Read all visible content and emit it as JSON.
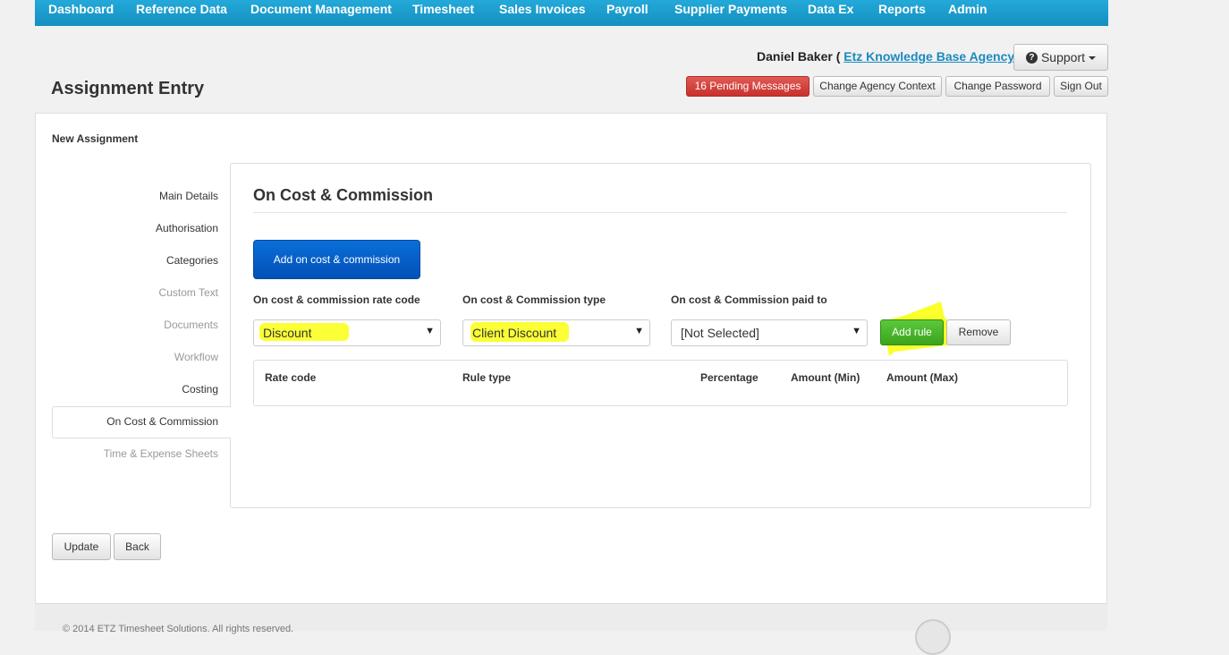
{
  "nav": {
    "items": [
      "Dashboard",
      "Reference Data",
      "Document Management",
      "Timesheet",
      "Sales Invoices",
      "Payroll",
      "Supplier Payments",
      "Data Ex",
      "Reports",
      "Admin"
    ]
  },
  "header": {
    "user_name": "Daniel Baker",
    "paren_open": "(",
    "agency_link": "Etz Knowledge Base Agency",
    "paren_close": ")",
    "support_label": "Support",
    "support_icon": "question-circle-icon",
    "pending_messages": "16 Pending Messages",
    "change_agency": "Change Agency Context",
    "change_password": "Change Password",
    "sign_out": "Sign Out",
    "pending_color": "#d9534f"
  },
  "page": {
    "title": "Assignment Entry",
    "subtitle": "New Assignment"
  },
  "sidenav": {
    "items": [
      {
        "label": "Main Details",
        "muted": false
      },
      {
        "label": "Authorisation",
        "muted": false
      },
      {
        "label": "Categories",
        "muted": false
      },
      {
        "label": "Custom Text",
        "muted": true
      },
      {
        "label": "Documents",
        "muted": true
      },
      {
        "label": "Workflow",
        "muted": true
      },
      {
        "label": "Costing",
        "muted": false
      },
      {
        "label": "On Cost & Commission",
        "muted": false,
        "active": true
      },
      {
        "label": "Time & Expense Sheets",
        "muted": true
      }
    ]
  },
  "section": {
    "title": "On Cost & Commission",
    "add_button": "Add on cost & commission",
    "rate_code_label": "On cost & commission rate code",
    "rate_code_value": "Discount",
    "type_label": "On cost & Commission type",
    "type_value": "Client Discount",
    "paid_to_label": "On cost & Commission paid to",
    "paid_to_value": "[Not Selected]",
    "add_rule": "Add rule",
    "remove": "Remove",
    "highlight_color": "#fbff2a",
    "primary_color": "#0555c4",
    "success_color": "#4cb82c"
  },
  "table": {
    "columns": [
      "Rate code",
      "Rule type",
      "Percentage",
      "Amount (Min)",
      "Amount (Max)"
    ],
    "rows": []
  },
  "actions": {
    "update": "Update",
    "back": "Back"
  },
  "footer": {
    "text": "© 2014 ETZ Timesheet Solutions. All rights reserved."
  }
}
